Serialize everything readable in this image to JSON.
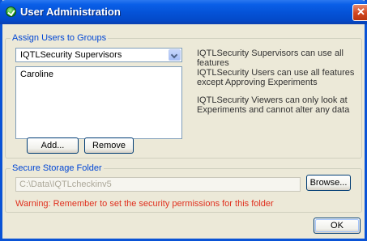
{
  "window": {
    "title": "User Administration",
    "close_glyph": "✕",
    "icon": "green-check-icon",
    "title_color": "#0553d8"
  },
  "groups_section": {
    "legend": "Assign Users to Groups",
    "group_select": {
      "value": "IQTLSecurity Supervisors"
    },
    "users": [
      "Caroline"
    ],
    "add_label": "Add...",
    "remove_label": "Remove",
    "descriptions": [
      "IQTLSecurity Supervisors can use all features",
      "IQTLSecurity Users can use all features except Approving Experiments",
      "IQTLSecurity Viewers can only look at Experiments and cannot alter any data"
    ]
  },
  "storage_section": {
    "legend": "Secure Storage Folder",
    "path_value": "C:\\Data\\IQTLcheckinv5",
    "browse_label": "Browse...",
    "warning": "Warning: Remember to set the security permissions for this folder",
    "warning_color": "#e0301e"
  },
  "footer": {
    "ok_label": "OK"
  }
}
